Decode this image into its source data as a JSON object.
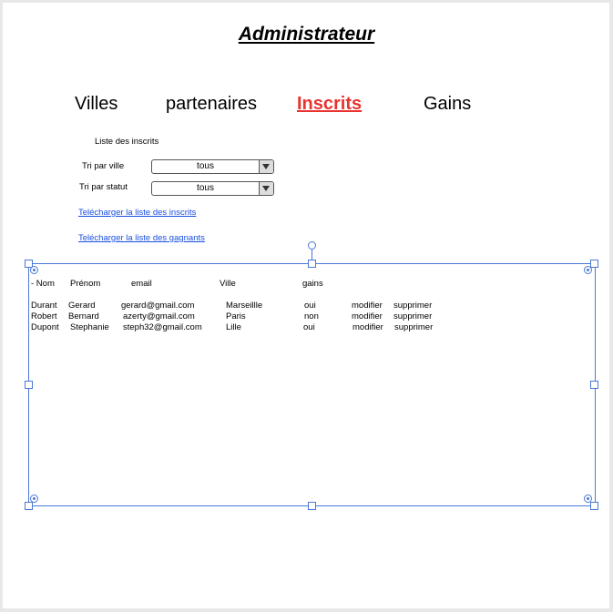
{
  "title": "Administrateur",
  "nav": [
    {
      "label": "Villes"
    },
    {
      "label": "partenaires"
    },
    {
      "label": "Inscrits",
      "active": true
    },
    {
      "label": "Gains"
    }
  ],
  "section_label": "Liste des inscrits",
  "filters": [
    {
      "label": "Tri par ville",
      "value": "tous"
    },
    {
      "label": "Tri par statut",
      "value": "tous"
    }
  ],
  "links": [
    "Telécharger la liste des inscrits",
    "Telécharger la liste des gagnants"
  ],
  "table": {
    "headers": [
      "- Nom",
      "Prénom",
      "email",
      "Ville",
      "gains"
    ],
    "rows": [
      {
        "nom": "Durant",
        "prenom": "Gerard",
        "email": "gerard@gmail.com",
        "ville": "Marseillle",
        "gains": "oui",
        "edit": "modifier",
        "delete": "supprimer"
      },
      {
        "nom": "Robert",
        "prenom": "Bernard",
        "email": "azerty@gmail.com",
        "ville": "Paris",
        "gains": "non",
        "edit": "modifier",
        "delete": "supprimer"
      },
      {
        "nom": "Dupont",
        "prenom": "Stephanie",
        "email": "steph32@gmail.com",
        "ville": "Lille",
        "gains": "oui",
        "edit": "modifier",
        "delete": "supprimer"
      }
    ]
  },
  "colors": {
    "accent": "#e8332f",
    "link": "#1a4fe0",
    "selection": "#4a78d8"
  }
}
